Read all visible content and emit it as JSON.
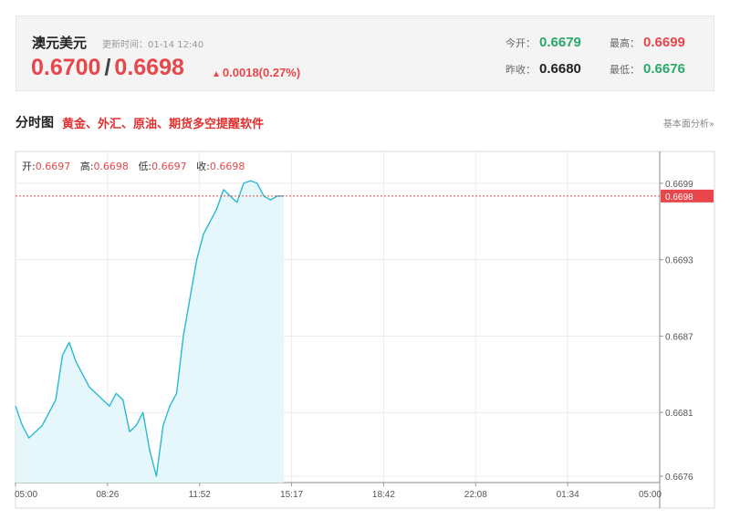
{
  "quote": {
    "name": "澳元美元",
    "update_time": "更新时间：01-14 12:40",
    "bid": "0.6700",
    "ask": "0.6698",
    "change": "0.0018(0.27%)",
    "open_label": "今开：",
    "open_value": "0.6679",
    "high_label": "最高：",
    "high_value": "0.6699",
    "prev_close_label": "昨收：",
    "prev_close_value": "0.6680",
    "low_label": "最低：",
    "low_value": "0.6676"
  },
  "section": {
    "title": "分时图",
    "promo": "黄金、外汇、原油、期货多空提醒软件",
    "link": "基本面分析»"
  },
  "ohlc": {
    "open_label": "开:",
    "open": "0.6697",
    "high_label": "高:",
    "high": "0.6698",
    "low_label": "低:",
    "low": "0.6697",
    "close_label": "收:",
    "close": "0.6698"
  },
  "colors": {
    "up": "#e8464a",
    "down": "#2aa86a",
    "line": "#29b8d4",
    "fill": "#e6f7fc"
  },
  "chart_data": {
    "type": "line",
    "x_ticks": [
      "05:00",
      "08:26",
      "11:52",
      "15:17",
      "18:42",
      "22:08",
      "01:34",
      "05:00"
    ],
    "y_ticks": [
      0.6676,
      0.6681,
      0.6687,
      0.6693,
      0.6699
    ],
    "y_tick_labels": [
      "0.6676",
      "0.6681",
      "0.6687",
      "0.6693",
      "0.6699"
    ],
    "ylim": [
      0.66755,
      0.67015
    ],
    "current_price": 0.6698,
    "current_price_label": "0.6698",
    "grid": true,
    "x_hours": [
      0,
      0.25,
      0.5,
      0.75,
      1.0,
      1.25,
      1.5,
      1.75,
      2.0,
      2.25,
      2.5,
      2.75,
      3.0,
      3.25,
      3.5,
      3.75,
      4.0,
      4.25,
      4.5,
      4.75,
      5.0,
      5.25,
      5.5,
      5.75,
      6.0,
      6.25,
      6.5,
      6.75,
      7.0,
      7.25,
      7.5,
      7.75,
      8.0,
      8.25,
      8.5,
      8.75,
      9.0,
      9.25,
      9.5,
      9.75,
      10.0
    ],
    "values": [
      0.66815,
      0.668,
      0.6679,
      0.66795,
      0.668,
      0.6681,
      0.6682,
      0.66855,
      0.66865,
      0.6685,
      0.6684,
      0.6683,
      0.66825,
      0.6682,
      0.66815,
      0.66825,
      0.6682,
      0.66795,
      0.668,
      0.6681,
      0.6678,
      0.6676,
      0.668,
      0.66815,
      0.66825,
      0.6687,
      0.669,
      0.6693,
      0.6695,
      0.6696,
      0.6697,
      0.66985,
      0.6698,
      0.66975,
      0.6699,
      0.66992,
      0.6699,
      0.6698,
      0.66977,
      0.6698,
      0.6698
    ]
  }
}
